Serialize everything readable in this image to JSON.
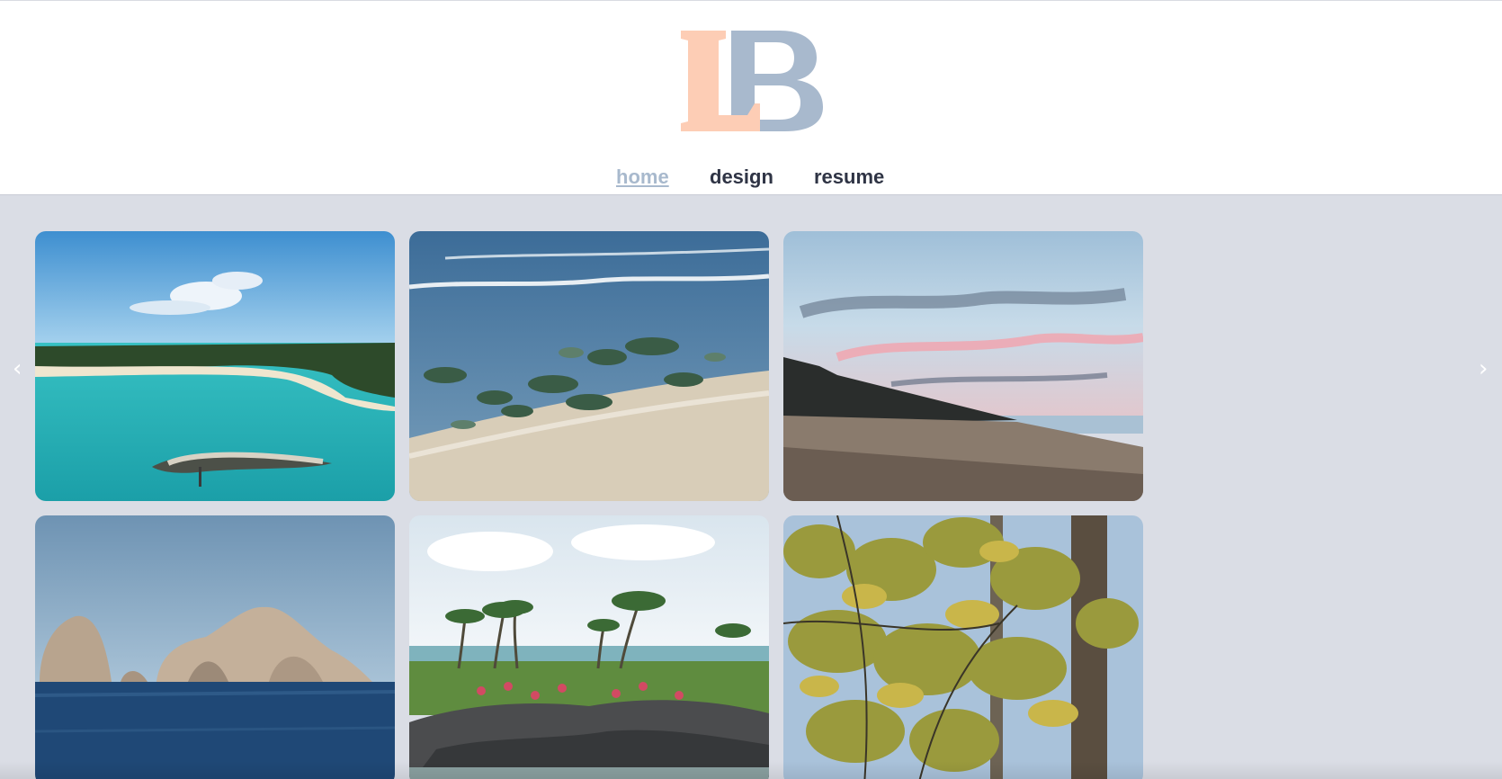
{
  "brand": {
    "logo_letters": "LB",
    "colors": {
      "L": "#fdcdb5",
      "B": "#a8b9cd"
    }
  },
  "nav": {
    "items": [
      {
        "label": "home",
        "active": true
      },
      {
        "label": "design",
        "active": false
      },
      {
        "label": "resume",
        "active": false
      }
    ],
    "active_color": "#a8b9cd",
    "color": "#2f3445"
  },
  "gallery": {
    "background": "#dadde5",
    "prev_arrow": "‹",
    "next_arrow": "›",
    "photos": [
      {
        "subject": "tropical-island-lagoon"
      },
      {
        "subject": "rocky-beach-shoreline"
      },
      {
        "subject": "sunset-sandy-beach"
      },
      {
        "subject": "sea-rock-formations"
      },
      {
        "subject": "palm-trees-garden-coast"
      },
      {
        "subject": "autumn-tree-leaves"
      }
    ]
  }
}
